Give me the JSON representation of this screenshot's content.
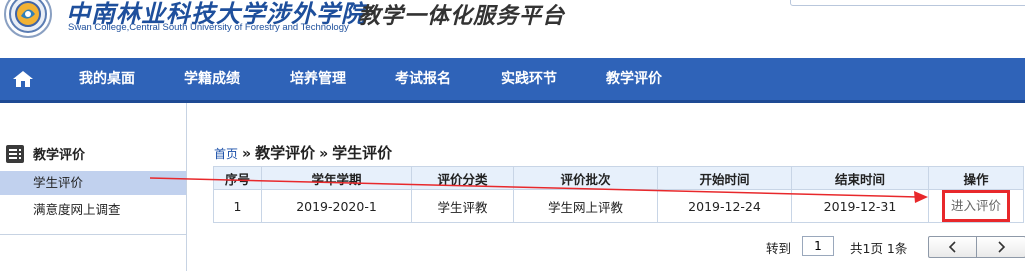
{
  "header": {
    "school_name_cn": "中南林业科技大学涉外学院",
    "school_name_en": "Swan College,Central South University of Forestry and Technology",
    "platform_title": "教学一体化服务平台",
    "logo_icon": "college-seal-logo"
  },
  "nav": {
    "home_icon": "home-icon",
    "items": [
      {
        "label": "我的桌面"
      },
      {
        "label": "学籍成绩"
      },
      {
        "label": "培养管理"
      },
      {
        "label": "考试报名"
      },
      {
        "label": "实践环节"
      },
      {
        "label": "教学评价"
      }
    ]
  },
  "sidebar": {
    "heading": "教学评价",
    "heading_icon": "list-icon",
    "items": [
      {
        "label": "学生评价",
        "active": true
      },
      {
        "label": "满意度网上调查",
        "active": false
      }
    ]
  },
  "breadcrumb": {
    "home": "首页",
    "separator": "»",
    "level1": "教学评价",
    "level2": "学生评价"
  },
  "table": {
    "headers": [
      "序号",
      "学年学期",
      "评价分类",
      "评价批次",
      "开始时间",
      "结束时间",
      "操作"
    ],
    "rows": [
      {
        "index": "1",
        "term": "2019-2020-1",
        "category": "学生评教",
        "batch": "学生网上评教",
        "start": "2019-12-24",
        "end": "2019-12-31",
        "action": "进入评价"
      }
    ]
  },
  "pager": {
    "goto_label": "转到",
    "page_value": "1",
    "info": "共1页 1条",
    "prev_icon": "chevron-left-icon",
    "next_icon": "chevron-right-icon"
  },
  "colors": {
    "nav_bg": "#2f63b8",
    "brand_blue": "#1e4f9c",
    "sidebar_active": "#c1d1ee",
    "table_header_bg": "#e7f0fb",
    "annotation_red": "#e8282b"
  }
}
